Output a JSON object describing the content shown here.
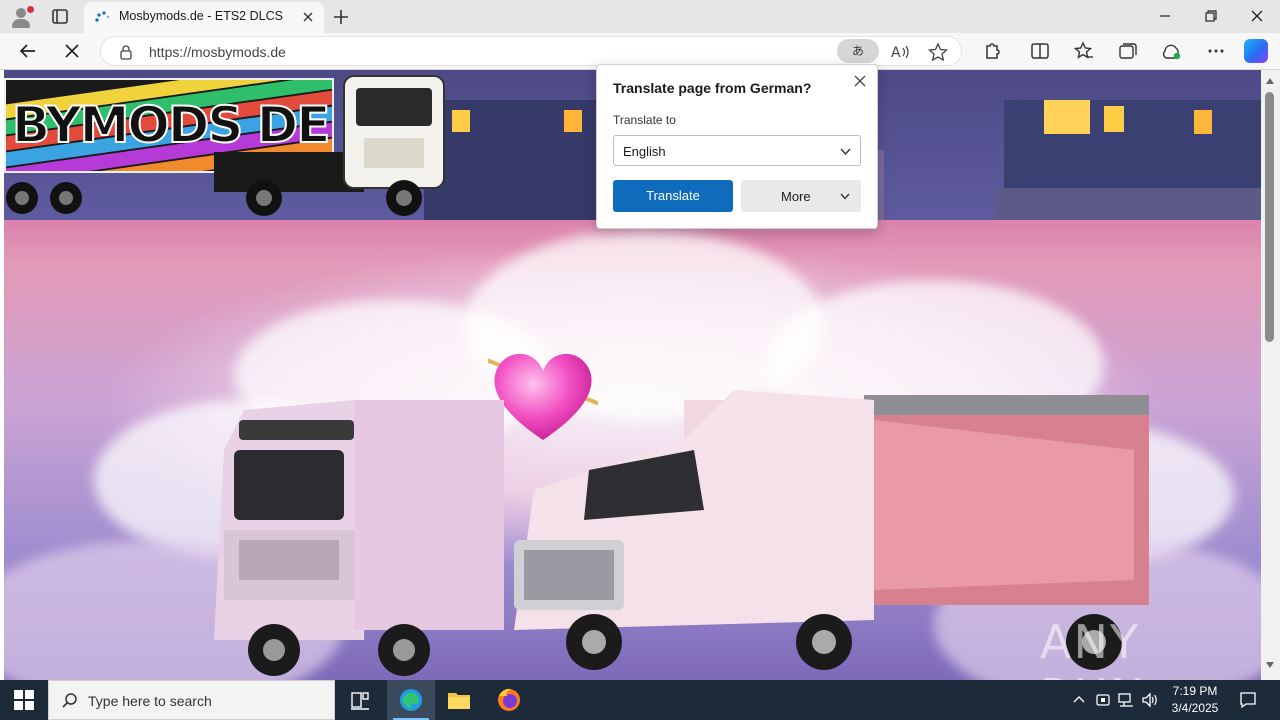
{
  "browser": {
    "tab_title": "Mosbymods.de - ETS2 DLCS",
    "url": "https://mosbymods.de",
    "translate_badge": "あ"
  },
  "translate_popup": {
    "title": "Translate page from German?",
    "label": "Translate to",
    "selected_language": "English",
    "translate_button": "Translate",
    "more_button": "More"
  },
  "page": {
    "logo_text": "BYMODS DE",
    "watermark": "ANY RUN"
  },
  "taskbar": {
    "search_placeholder": "Type here to search",
    "time": "7:19 PM",
    "date": "3/4/2025"
  },
  "colors": {
    "accent": "#0f6cbd",
    "taskbar": "#1c2a3a"
  }
}
